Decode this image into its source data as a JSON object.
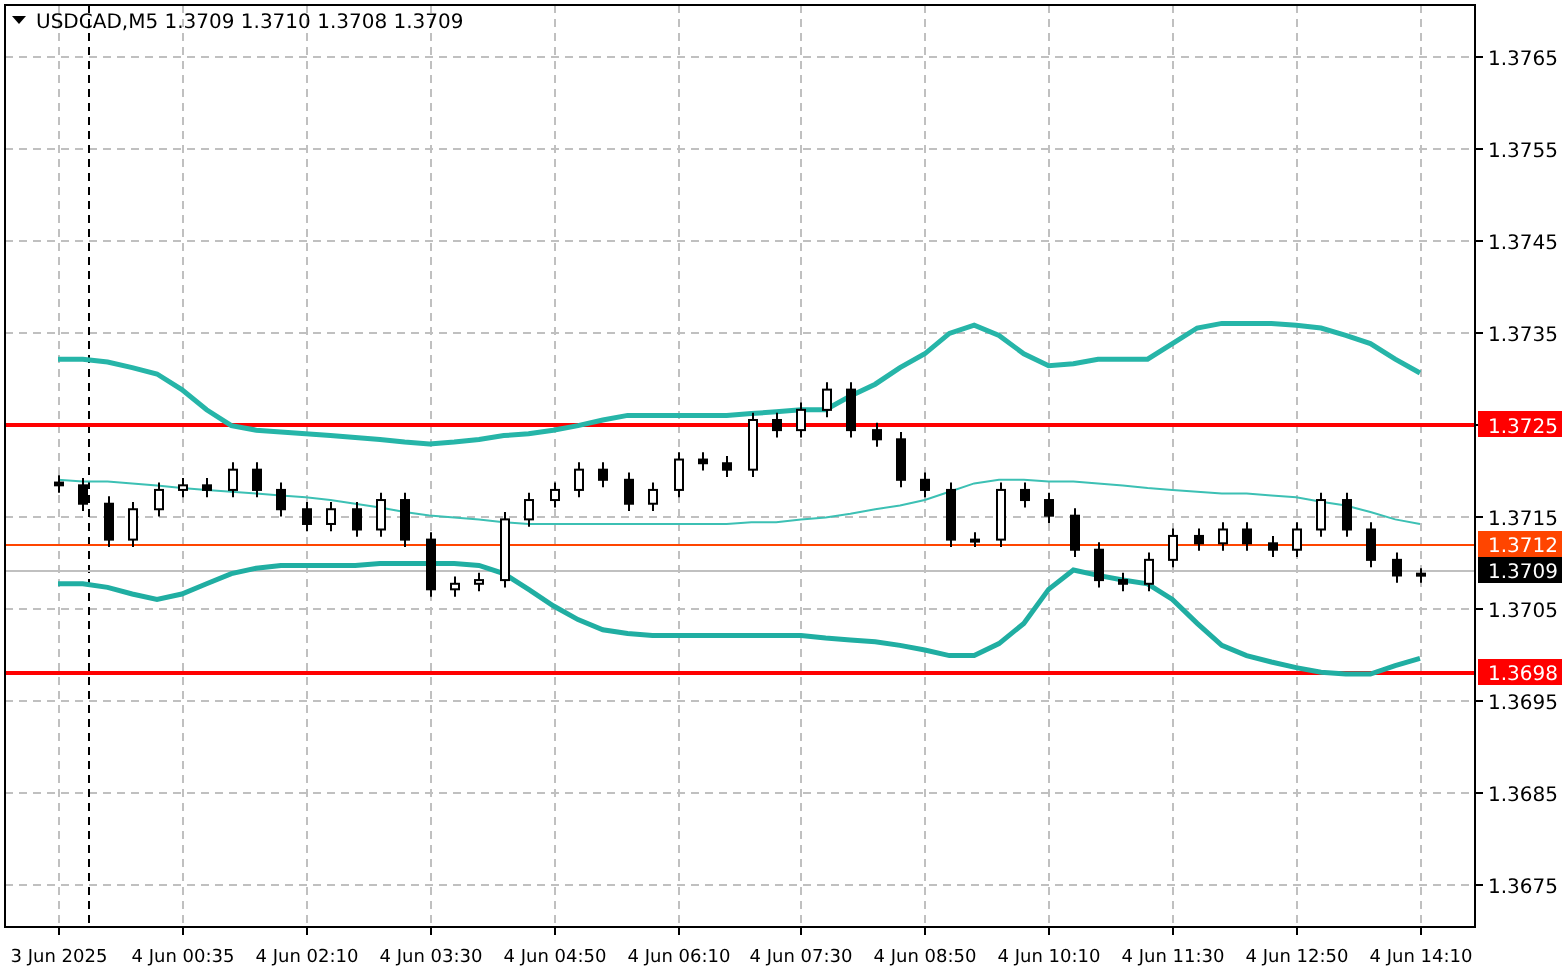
{
  "chart_data": {
    "type": "candlestick",
    "title": "USDCAD,M5 1.3709 1.3710 1.3708 1.3709",
    "grid": true,
    "categories": [
      "3 Jun 2025",
      null,
      null,
      null,
      null,
      "4 Jun 00:35",
      null,
      null,
      null,
      null,
      "4 Jun 02:10",
      null,
      null,
      null,
      null,
      "4 Jun 03:30",
      null,
      null,
      null,
      null,
      "4 Jun 04:50",
      null,
      null,
      null,
      null,
      "4 Jun 06:10",
      null,
      null,
      null,
      null,
      "4 Jun 07:30",
      null,
      null,
      null,
      null,
      "4 Jun 08:50",
      null,
      null,
      null,
      null,
      "4 Jun 10:10",
      null,
      null,
      null,
      null,
      "4 Jun 11:30",
      null,
      null,
      null,
      null,
      "4 Jun 12:50",
      null,
      null,
      null,
      null,
      "4 Jun 14:10"
    ],
    "ylim": [
      1.36703,
      1.37705
    ],
    "yticks": [
      {
        "value": 1.3765,
        "label": "1.3765"
      },
      {
        "value": 1.3755,
        "label": "1.3755"
      },
      {
        "value": 1.3745,
        "label": "1.3745"
      },
      {
        "value": 1.3735,
        "label": "1.3735"
      },
      {
        "value": 1.3725,
        "label": "1.3725"
      },
      {
        "value": 1.3715,
        "label": "1.3715"
      },
      {
        "value": 1.3705,
        "label": "1.3705"
      },
      {
        "value": 1.3695,
        "label": "1.3695"
      },
      {
        "value": 1.3685,
        "label": "1.3685"
      },
      {
        "value": 1.3675,
        "label": "1.3675"
      }
    ],
    "ohlc": [
      [
        1.37186,
        1.37194,
        1.37175,
        1.37183
      ],
      [
        1.37183,
        1.37191,
        1.37155,
        1.37163
      ],
      [
        1.37163,
        1.37171,
        1.37116,
        1.37124
      ],
      [
        1.37124,
        1.37165,
        1.37116,
        1.37157
      ],
      [
        1.37157,
        1.37186,
        1.37149,
        1.37178
      ],
      [
        1.37178,
        1.37191,
        1.3717,
        1.37183
      ],
      [
        1.37183,
        1.37191,
        1.3717,
        1.37178
      ],
      [
        1.37178,
        1.37208,
        1.3717,
        1.372
      ],
      [
        1.372,
        1.37208,
        1.3717,
        1.37178
      ],
      [
        1.37178,
        1.37186,
        1.37149,
        1.37157
      ],
      [
        1.37157,
        1.37165,
        1.37133,
        1.37141
      ],
      [
        1.37141,
        1.37165,
        1.37133,
        1.37157
      ],
      [
        1.37157,
        1.37165,
        1.37127,
        1.37135
      ],
      [
        1.37135,
        1.37175,
        1.37127,
        1.37167
      ],
      [
        1.37167,
        1.37175,
        1.37116,
        1.37124
      ],
      [
        1.37124,
        1.37132,
        1.37062,
        1.3707
      ],
      [
        1.3707,
        1.37084,
        1.37062,
        1.37076
      ],
      [
        1.37076,
        1.37088,
        1.37068,
        1.3708
      ],
      [
        1.3708,
        1.37154,
        1.37072,
        1.37146
      ],
      [
        1.37146,
        1.37175,
        1.37138,
        1.37167
      ],
      [
        1.37167,
        1.37186,
        1.37159,
        1.37178
      ],
      [
        1.37178,
        1.37208,
        1.3717,
        1.372
      ],
      [
        1.372,
        1.37208,
        1.37181,
        1.37189
      ],
      [
        1.37189,
        1.37197,
        1.37155,
        1.37163
      ],
      [
        1.37163,
        1.37186,
        1.37155,
        1.37178
      ],
      [
        1.37178,
        1.37219,
        1.3717,
        1.37211
      ],
      [
        1.37211,
        1.37219,
        1.37199,
        1.37207
      ],
      [
        1.37207,
        1.37215,
        1.37192,
        1.372
      ],
      [
        1.372,
        1.37262,
        1.37192,
        1.37254
      ],
      [
        1.37254,
        1.37262,
        1.37235,
        1.37243
      ],
      [
        1.37243,
        1.37273,
        1.37235,
        1.37265
      ],
      [
        1.37265,
        1.37295,
        1.37257,
        1.37287
      ],
      [
        1.37287,
        1.37295,
        1.37235,
        1.37243
      ],
      [
        1.37243,
        1.37251,
        1.37225,
        1.37233
      ],
      [
        1.37233,
        1.37241,
        1.37181,
        1.37189
      ],
      [
        1.37189,
        1.37197,
        1.3717,
        1.37178
      ],
      [
        1.37178,
        1.37186,
        1.37116,
        1.37124
      ],
      [
        1.37124,
        1.37132,
        1.37116,
        1.37124
      ],
      [
        1.37124,
        1.37186,
        1.37116,
        1.37178
      ],
      [
        1.37178,
        1.37186,
        1.37159,
        1.37167
      ],
      [
        1.37167,
        1.37175,
        1.37142,
        1.3715
      ],
      [
        1.3715,
        1.37158,
        1.37105,
        1.37113
      ],
      [
        1.37113,
        1.37121,
        1.37072,
        1.3708
      ],
      [
        1.3708,
        1.37088,
        1.37068,
        1.37076
      ],
      [
        1.37076,
        1.3711,
        1.37068,
        1.37102
      ],
      [
        1.37102,
        1.37136,
        1.37094,
        1.37128
      ],
      [
        1.37128,
        1.37136,
        1.37112,
        1.3712
      ],
      [
        1.3712,
        1.37143,
        1.37112,
        1.37135
      ],
      [
        1.37135,
        1.37143,
        1.37112,
        1.3712
      ],
      [
        1.3712,
        1.37128,
        1.37105,
        1.37113
      ],
      [
        1.37113,
        1.37143,
        1.37105,
        1.37135
      ],
      [
        1.37135,
        1.37175,
        1.37127,
        1.37167
      ],
      [
        1.37167,
        1.37175,
        1.37127,
        1.37135
      ],
      [
        1.37135,
        1.37143,
        1.37094,
        1.37102
      ],
      [
        1.37102,
        1.3711,
        1.37077,
        1.37085
      ],
      [
        1.37085,
        1.37093,
        1.37077,
        1.37087
      ]
    ],
    "series": [
      {
        "type": "line",
        "color": "#26b5a8",
        "values": [
          1.3732,
          1.3732,
          1.37317,
          1.37311,
          1.37304,
          1.37287,
          1.37265,
          1.37248,
          1.37243,
          1.37241,
          1.37239,
          1.37237,
          1.37235,
          1.37233,
          1.3723,
          1.37228,
          1.3723,
          1.37233,
          1.37237,
          1.37239,
          1.37243,
          1.37248,
          1.37254,
          1.37259,
          1.37259,
          1.37259,
          1.37259,
          1.37259,
          1.37261,
          1.37263,
          1.37265,
          1.37265,
          1.3728,
          1.37293,
          1.37311,
          1.37326,
          1.37348,
          1.37357,
          1.37346,
          1.37326,
          1.37313,
          1.37315,
          1.3732,
          1.3732,
          1.3732,
          1.37337,
          1.37354,
          1.37359,
          1.37359,
          1.37359,
          1.37357,
          1.37354,
          1.37346,
          1.37337,
          1.3732,
          1.37305
        ]
      },
      {
        "type": "line",
        "color": "#3cc0b4",
        "values": [
          1.37189,
          1.37187,
          1.37187,
          1.37185,
          1.37183,
          1.3718,
          1.37178,
          1.37176,
          1.37174,
          1.37172,
          1.3717,
          1.37167,
          1.37163,
          1.37159,
          1.37154,
          1.3715,
          1.37148,
          1.37146,
          1.37143,
          1.37141,
          1.37141,
          1.37141,
          1.37141,
          1.37141,
          1.37141,
          1.37141,
          1.37141,
          1.37141,
          1.37143,
          1.37143,
          1.37146,
          1.37148,
          1.37152,
          1.37157,
          1.37161,
          1.37167,
          1.37176,
          1.37185,
          1.37189,
          1.37189,
          1.37187,
          1.37187,
          1.37185,
          1.37183,
          1.3718,
          1.37178,
          1.37176,
          1.37174,
          1.37174,
          1.37172,
          1.3717,
          1.37165,
          1.37161,
          1.37154,
          1.37146,
          1.37141
        ]
      },
      {
        "type": "line",
        "color": "#20aea2",
        "values": [
          1.37076,
          1.37076,
          1.37072,
          1.37065,
          1.37059,
          1.37065,
          1.37076,
          1.37087,
          1.37093,
          1.37096,
          1.37096,
          1.37096,
          1.37096,
          1.37098,
          1.37098,
          1.37098,
          1.37098,
          1.37096,
          1.37087,
          1.3707,
          1.37052,
          1.37037,
          1.37026,
          1.37022,
          1.3702,
          1.3702,
          1.3702,
          1.3702,
          1.3702,
          1.3702,
          1.3702,
          1.37017,
          1.37015,
          1.37013,
          1.37009,
          1.37004,
          1.36998,
          1.36998,
          1.37011,
          1.37033,
          1.3707,
          1.37091,
          1.37085,
          1.3708,
          1.37076,
          1.37059,
          1.37033,
          1.37009,
          1.36998,
          1.36991,
          1.36985,
          1.3698,
          1.36978,
          1.36978,
          1.36987,
          1.36995
        ]
      }
    ],
    "ref_lines": [
      {
        "axis": "y",
        "value": 1.3725,
        "color": "#ff0000"
      },
      {
        "axis": "y",
        "value": 1.3712,
        "label": "1.3712",
        "color": "#ff4500"
      },
      {
        "axis": "y",
        "value": 1.3709,
        "label": "1.3709",
        "color": "#c0c0c0"
      },
      {
        "axis": "y",
        "value": 1.3698,
        "label": "1.3698",
        "color": "#ff0000"
      }
    ]
  }
}
